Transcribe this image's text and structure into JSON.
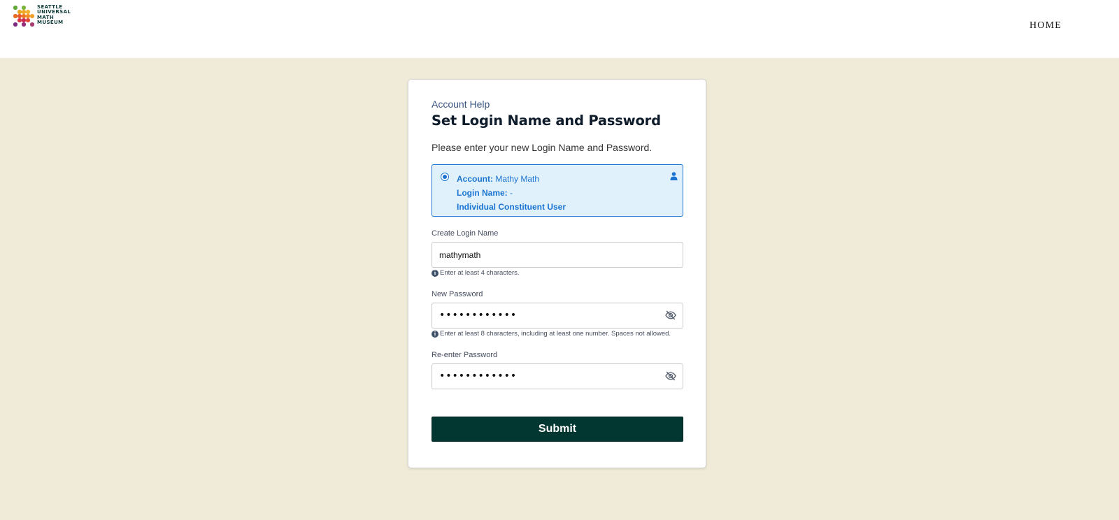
{
  "header": {
    "logo_lines": [
      "SEATTLE",
      "UNIVERSAL",
      "MATH",
      "MUSEUM"
    ],
    "nav_home": "HOME"
  },
  "card": {
    "eyebrow": "Account Help",
    "title": "Set Login Name and Password",
    "subtitle": "Please enter your new Login Name and Password.",
    "account": {
      "account_label": "Account:",
      "account_value": "Mathy Math",
      "login_label": "Login Name:",
      "login_value": "-",
      "user_type": "Individual Constituent User",
      "selected": true,
      "icon": "person-icon"
    },
    "login_field": {
      "label": "Create Login Name",
      "value": "mathymath",
      "hint": "Enter at least 4 characters."
    },
    "password_field": {
      "label": "New Password",
      "masked_value": "••••••••••••",
      "hint": "Enter at least 8 characters, including at least one number. Spaces not allowed.",
      "icon": "eye-slash-icon"
    },
    "reenter_field": {
      "label": "Re-enter Password",
      "masked_value": "••••••••••••",
      "icon": "eye-slash-icon"
    },
    "submit_label": "Submit"
  },
  "colors": {
    "page_background": "#f0ebd8",
    "accent_blue": "#1b74d1",
    "account_box_bg": "#e0f1fc",
    "submit_bg": "#023631"
  }
}
